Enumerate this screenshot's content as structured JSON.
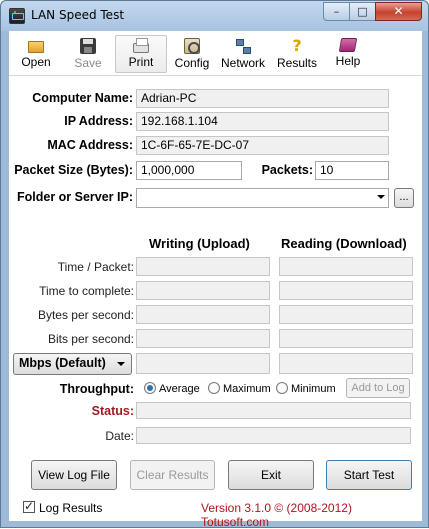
{
  "window": {
    "title": "LAN Speed Test"
  },
  "toolbar": {
    "items": [
      {
        "label": "Open"
      },
      {
        "label": "Save"
      },
      {
        "label": "Print"
      },
      {
        "label": "Config"
      },
      {
        "label": "Network"
      },
      {
        "label": "Results"
      },
      {
        "label": "Help"
      }
    ]
  },
  "info": {
    "computer_name_label": "Computer Name:",
    "computer_name": "Adrian-PC",
    "ip_label": "IP Address:",
    "ip": "192.168.1.104",
    "mac_label": "MAC Address:",
    "mac": "1C-6F-65-7E-DC-07",
    "packet_size_label": "Packet Size (Bytes):",
    "packet_size": "1,000,000",
    "packets_label": "Packets:",
    "packets": "10",
    "folder_label": "Folder or Server IP:",
    "folder_value": "",
    "browse_label": "..."
  },
  "results": {
    "writing_head": "Writing (Upload)",
    "reading_head": "Reading (Download)",
    "rows": [
      {
        "label": "Time / Packet:",
        "write": "",
        "read": ""
      },
      {
        "label": "Time to complete:",
        "write": "",
        "read": ""
      },
      {
        "label": "Bytes per second:",
        "write": "",
        "read": ""
      },
      {
        "label": "Bits per second:",
        "write": "",
        "read": ""
      }
    ],
    "unit_select": "Mbps (Default)",
    "unit_write": "",
    "unit_read": ""
  },
  "throughput": {
    "label": "Throughput:",
    "options": [
      "Average",
      "Maximum",
      "Minimum"
    ],
    "selected": "Average",
    "add_to_log": "Add to Log"
  },
  "status": {
    "label": "Status:",
    "value": ""
  },
  "date": {
    "label": "Date:",
    "value": ""
  },
  "buttons": {
    "view_log": "View Log File",
    "clear_results": "Clear Results",
    "exit": "Exit",
    "start_test": "Start Test"
  },
  "footer": {
    "log_results_label": "Log Results",
    "log_results_checked": true,
    "version_text": "Version 3.1.0  © (2008-2012) Totusoft.com"
  }
}
